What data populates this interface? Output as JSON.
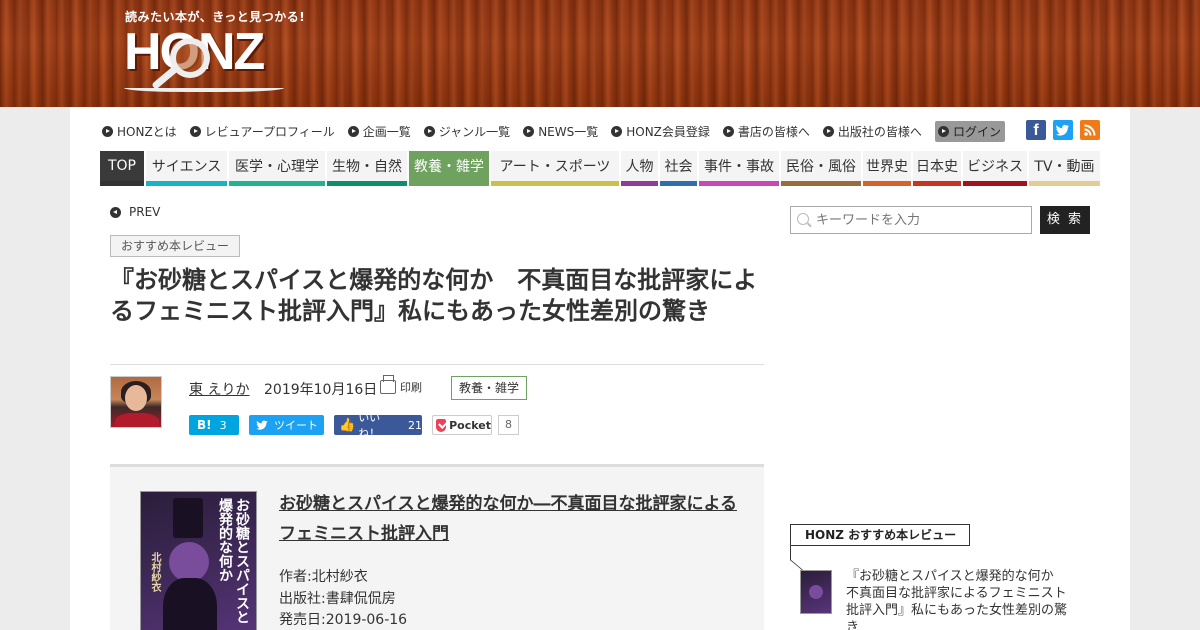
{
  "header": {
    "tagline": "読みたい本が、きっと見つかる!",
    "logo_text": "HONZ"
  },
  "util_nav": {
    "items": [
      "HONZとは",
      "レビュアープロフィール",
      "企画一覧",
      "ジャンル一覧",
      "NEWS一覧",
      "HONZ会員登録",
      "書店の皆様へ",
      "出版社の皆様へ"
    ],
    "login": "ログイン",
    "social": {
      "facebook": "f",
      "twitter": "t",
      "rss": "r"
    }
  },
  "categories": [
    {
      "label": "TOP",
      "color": "#333333"
    },
    {
      "label": "サイエンス",
      "color": "#17b4c4"
    },
    {
      "label": "医学・心理学",
      "color": "#1fb38e"
    },
    {
      "label": "生物・自然",
      "color": "#0b8f6a"
    },
    {
      "label": "教養・雑学",
      "color": "#6fa15f"
    },
    {
      "label": "アート・スポーツ",
      "color": "#c8c24a"
    },
    {
      "label": "人物",
      "color": "#8b3d9e"
    },
    {
      "label": "社会",
      "color": "#2f6db0"
    },
    {
      "label": "事件・事故",
      "color": "#c848b8"
    },
    {
      "label": "民俗・風俗",
      "color": "#9b6a3d"
    },
    {
      "label": "世界史",
      "color": "#d8612a"
    },
    {
      "label": "日本史",
      "color": "#c8341f"
    },
    {
      "label": "ビジネス",
      "color": "#a4101e"
    },
    {
      "label": "TV・動画",
      "color": "#e3cd94"
    }
  ],
  "prev_label": "PREV",
  "article": {
    "tag": "おすすめ本レビュー",
    "title": "『お砂糖とスパイスと爆発的な何か　不真面目な批評家によるフェミニスト批評入門』私にもあった女性差別の驚き",
    "author": "東 えりか",
    "date": "2019年10月16日",
    "print_label": "印刷",
    "category_tag": "教養・雑学"
  },
  "share": {
    "hatena_label": "B!",
    "hatena_count": "3",
    "tweet_label": "ツイート",
    "like_label": "いいね！",
    "like_count": "21",
    "pocket_label": "Pocket",
    "pocket_count": "8"
  },
  "book": {
    "title": "お砂糖とスパイスと爆発的な何か―不真面目な批評家によるフェミニスト批評入門",
    "author": "作者:北村紗衣",
    "publisher": "出版社:書肆侃侃房",
    "release": "発売日:2019-06-16",
    "cover_title_1": "お砂糖とスパイスと",
    "cover_title_2": "爆発的な何か",
    "cover_author": "北村紗衣"
  },
  "sidebar": {
    "search_placeholder": "キーワードを入力",
    "search_button": "検 索",
    "rec_heading": "HONZ おすすめ本レビュー",
    "rec_item": "『お砂糖とスパイスと爆発的な何か　不真面目な批評家によるフェミニスト批評入門』私にもあった女性差別の驚き"
  }
}
